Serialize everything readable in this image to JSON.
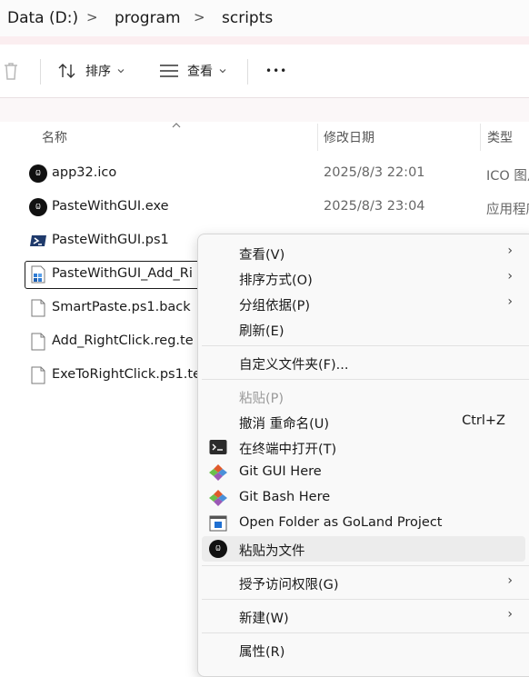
{
  "breadcrumb": {
    "items": [
      "Data (D:)",
      "program",
      "scripts"
    ],
    "separator": ">"
  },
  "toolbar": {
    "sort_label": "排序",
    "view_label": "查看",
    "more_label": "•••"
  },
  "columns": {
    "name": "名称",
    "date": "修改日期",
    "type": "类型"
  },
  "files": [
    {
      "name": "app32.ico",
      "date": "2025/8/3 22:01",
      "type": "ICO 图片",
      "icon": "app-logo-icon"
    },
    {
      "name": "PasteWithGUI.exe",
      "date": "2025/8/3 23:04",
      "type": "应用程序",
      "icon": "app-logo-icon"
    },
    {
      "name": "PasteWithGUI.ps1",
      "date": "",
      "type": "",
      "icon": "powershell-icon"
    },
    {
      "name": "PasteWithGUI_Add_Ri",
      "date": "",
      "type": "",
      "icon": "registry-icon"
    },
    {
      "name": "SmartPaste.ps1.back",
      "date": "",
      "type": "",
      "icon": "file-icon"
    },
    {
      "name": "Add_RightClick.reg.te",
      "date": "",
      "type": "",
      "icon": "file-icon"
    },
    {
      "name": "ExeToRightClick.ps1.te",
      "date": "",
      "type": "",
      "icon": "file-icon"
    }
  ],
  "menu": {
    "view": "查看(V)",
    "sort": "排序方式(O)",
    "group": "分组依据(P)",
    "refresh": "刷新(E)",
    "customize": "自定义文件夹(F)...",
    "paste": "粘贴(P)",
    "undo": "撤消 重命名(U)",
    "undo_shortcut": "Ctrl+Z",
    "terminal": "在终端中打开(T)",
    "git_gui": "Git GUI Here",
    "git_bash": "Git Bash Here",
    "goland": "Open Folder as GoLand Project",
    "paste_as_file": "粘贴为文件",
    "access": "授予访问权限(G)",
    "new": "新建(W)",
    "properties": "属性(R)",
    "arrow": "›"
  }
}
